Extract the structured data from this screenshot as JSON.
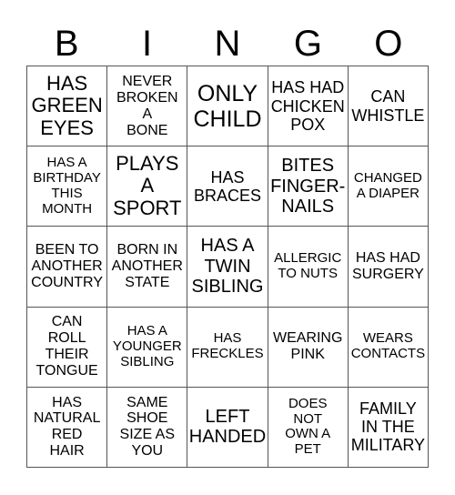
{
  "header": [
    "B",
    "I",
    "N",
    "G",
    "O"
  ],
  "cells": [
    [
      "HAS\nGREEN\nEYES",
      "NEVER\nBROKEN\nA\nBONE",
      "ONLY\nCHILD",
      "HAS HAD\nCHICKEN\nPOX",
      "CAN\nWHISTLE"
    ],
    [
      "HAS A\nBIRTHDAY\nTHIS\nMONTH",
      "PLAYS\nA\nSPORT",
      "HAS\nBRACES",
      "BITES\nFINGER-\nNAILS",
      "CHANGED\nA DIAPER"
    ],
    [
      "BEEN TO\nANOTHER\nCOUNTRY",
      "BORN IN\nANOTHER\nSTATE",
      "HAS A\nTWIN\nSIBLING",
      "ALLERGIC\nTO NUTS",
      "HAS HAD\nSURGERY"
    ],
    [
      "CAN\nROLL\nTHEIR\nTONGUE",
      "HAS A\nYOUNGER\nSIBLING",
      "HAS\nFRECKLES",
      "WEARING\nPINK",
      "WEARS\nCONTACTS"
    ],
    [
      "HAS\nNATURAL\nRED\nHAIR",
      "SAME\nSHOE\nSIZE AS\nYOU",
      "LEFT\nHANDED",
      "DOES\nNOT\nOWN A\nPET",
      "FAMILY\nIN THE\nMILITARY"
    ]
  ]
}
